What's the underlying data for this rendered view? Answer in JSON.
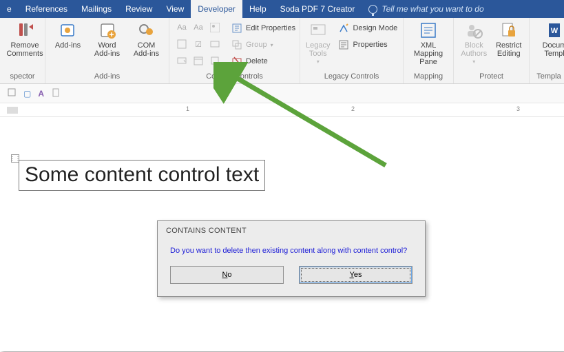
{
  "tabs": {
    "items": [
      "e",
      "References",
      "Mailings",
      "Review",
      "View",
      "Developer",
      "Help",
      "Soda PDF 7 Creator"
    ],
    "active_index": 5,
    "tell_me": "Tell me what you want to do"
  },
  "ribbon": {
    "spector": {
      "remove": "Remove Comments",
      "label": "spector"
    },
    "addins": {
      "addins": "Add-ins",
      "word": "Word Add-ins",
      "com": "COM Add-ins",
      "label": "Add-ins"
    },
    "content_controls": {
      "edit_properties": "Edit Properties",
      "group": "Group",
      "delete": "Delete",
      "label": "Content Controls"
    },
    "legacy": {
      "tools": "Legacy Tools",
      "design": "Design Mode",
      "properties": "Properties",
      "label": "Legacy Controls"
    },
    "mapping": {
      "pane": "XML Mapping Pane",
      "label": "Mapping"
    },
    "protect": {
      "block": "Block Authors",
      "restrict": "Restrict Editing",
      "label": "Protect"
    },
    "templates": {
      "doc": "Docum Templ",
      "label": "Templa"
    }
  },
  "bar2": {
    "a": "A"
  },
  "ruler": {
    "marks": [
      "1",
      "2",
      "3"
    ]
  },
  "content_control_text": "Some content control text",
  "dialog": {
    "title": "CONTAINS CONTENT",
    "message": "Do you want to delete then existing content along with content control?",
    "no_prefix": "N",
    "no_rest": "o",
    "yes_prefix": "Y",
    "yes_rest": "es"
  }
}
